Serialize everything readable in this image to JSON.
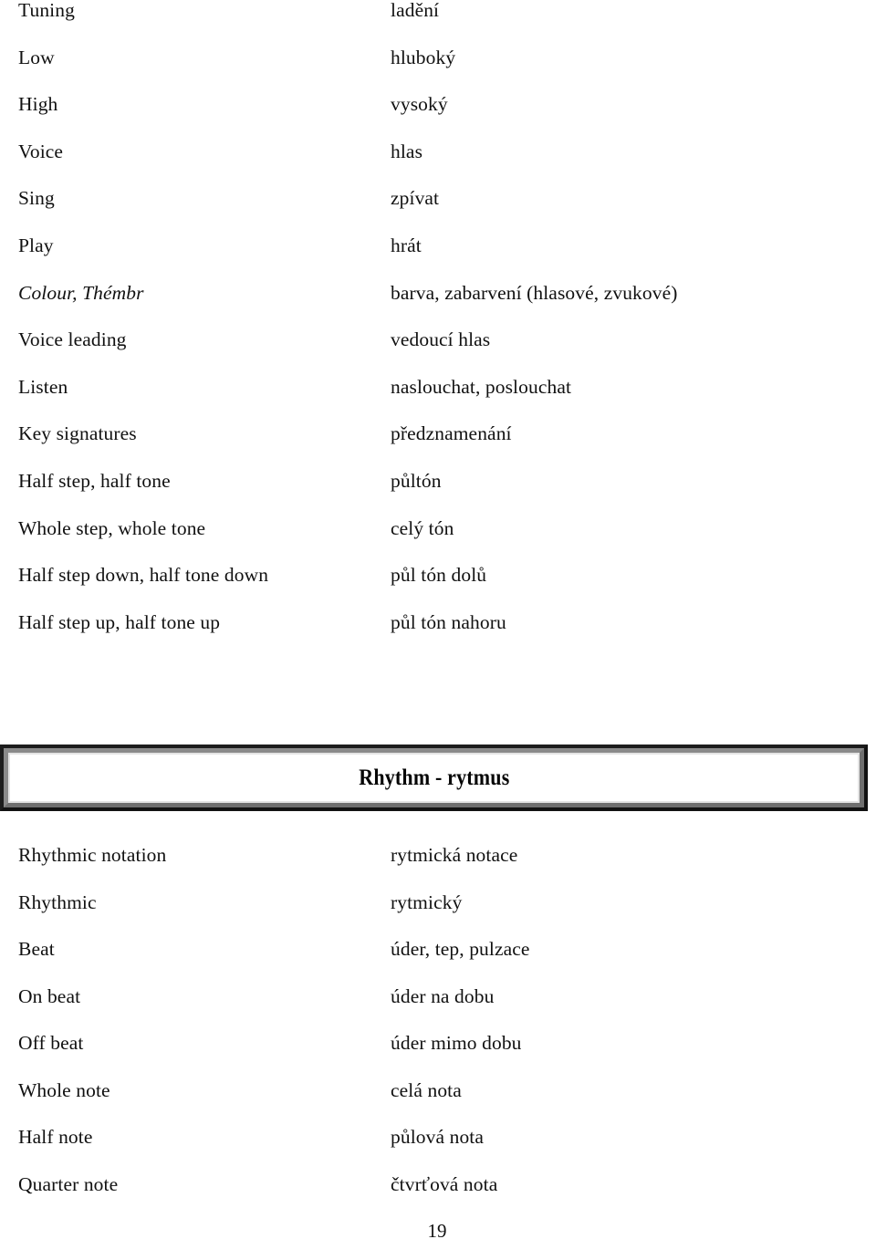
{
  "document": {
    "page_number": "19"
  },
  "sections": [
    {
      "id": "pitch-voice",
      "entries": [
        {
          "term": "Tuning",
          "translation": "ladění",
          "italic": false
        },
        {
          "term": "Low",
          "translation": "hluboký",
          "italic": false
        },
        {
          "term": "High",
          "translation": "vysoký",
          "italic": false
        },
        {
          "term": "Voice",
          "translation": "hlas",
          "italic": false
        },
        {
          "term": "Sing",
          "translation": "zpívat",
          "italic": false
        },
        {
          "term": "Play",
          "translation": "hrát",
          "italic": false
        },
        {
          "term": "Colour, Thémbr",
          "translation": "barva, zabarvení (hlasové, zvukové)",
          "italic": true
        },
        {
          "term": "Voice leading",
          "translation": "vedoucí hlas",
          "italic": false
        },
        {
          "term": "Listen",
          "translation": "naslouchat, poslouchat",
          "italic": false
        },
        {
          "term": "Key signatures",
          "translation": "předznamenání",
          "italic": false
        },
        {
          "term": "Half step, half tone",
          "translation": "půltón",
          "italic": false
        },
        {
          "term": "Whole step, whole tone",
          "translation": "celý tón",
          "italic": false
        },
        {
          "term": "Half step down, half tone down",
          "translation": "půl tón dolů",
          "italic": false
        },
        {
          "term": "Half step up, half tone up",
          "translation": "půl tón nahoru",
          "italic": false
        }
      ]
    },
    {
      "id": "rhythm",
      "header": "Rhythm - rytmus",
      "entries": [
        {
          "term": "Rhythmic notation",
          "translation": "rytmická notace",
          "italic": false
        },
        {
          "term": "Rhythmic",
          "translation": "rytmický",
          "italic": false
        },
        {
          "term": "Beat",
          "translation": "úder, tep, pulzace",
          "italic": false
        },
        {
          "term": "On beat",
          "translation": "úder na dobu",
          "italic": false
        },
        {
          "term": "Off beat",
          "translation": "úder mimo dobu",
          "italic": false
        },
        {
          "term": "Whole note",
          "translation": "celá nota",
          "italic": false
        },
        {
          "term": "Half note",
          "translation": "půlová nota",
          "italic": false
        },
        {
          "term": "Quarter note",
          "translation": "čtvrťová nota",
          "italic": false
        }
      ]
    }
  ]
}
